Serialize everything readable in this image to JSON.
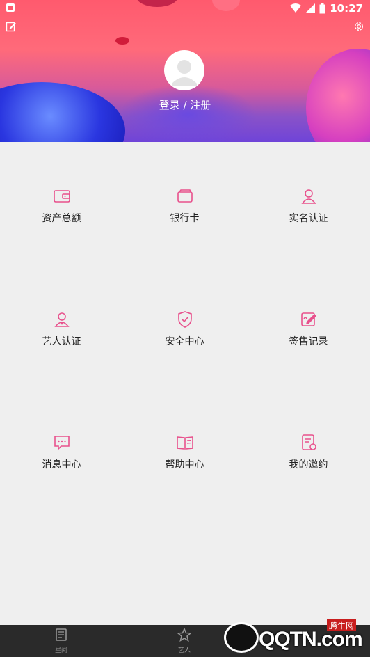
{
  "status_bar": {
    "time": "10:27"
  },
  "header": {
    "login_text": "登录 / 注册"
  },
  "menu": [
    {
      "label": "资产总额",
      "icon": "wallet-icon"
    },
    {
      "label": "银行卡",
      "icon": "bank-card-icon"
    },
    {
      "label": "实名认证",
      "icon": "user-verify-icon"
    },
    {
      "label": "艺人认证",
      "icon": "artist-verify-icon"
    },
    {
      "label": "安全中心",
      "icon": "shield-check-icon"
    },
    {
      "label": "签售记录",
      "icon": "sign-record-icon"
    },
    {
      "label": "消息中心",
      "icon": "message-icon"
    },
    {
      "label": "帮助中心",
      "icon": "book-icon"
    },
    {
      "label": "我的邀约",
      "icon": "invitation-icon"
    }
  ],
  "tabbar": [
    {
      "label": "星闻",
      "icon": "news-icon"
    },
    {
      "label": "艺人",
      "icon": "star-icon"
    }
  ],
  "watermark": {
    "text": "QQTN.com",
    "sub": "腾牛网"
  },
  "colors": {
    "accent": "#e8508c",
    "header_top": "#ff5a6e",
    "tabbar_bg": "#2a2a2a",
    "page_bg": "#efefef"
  }
}
